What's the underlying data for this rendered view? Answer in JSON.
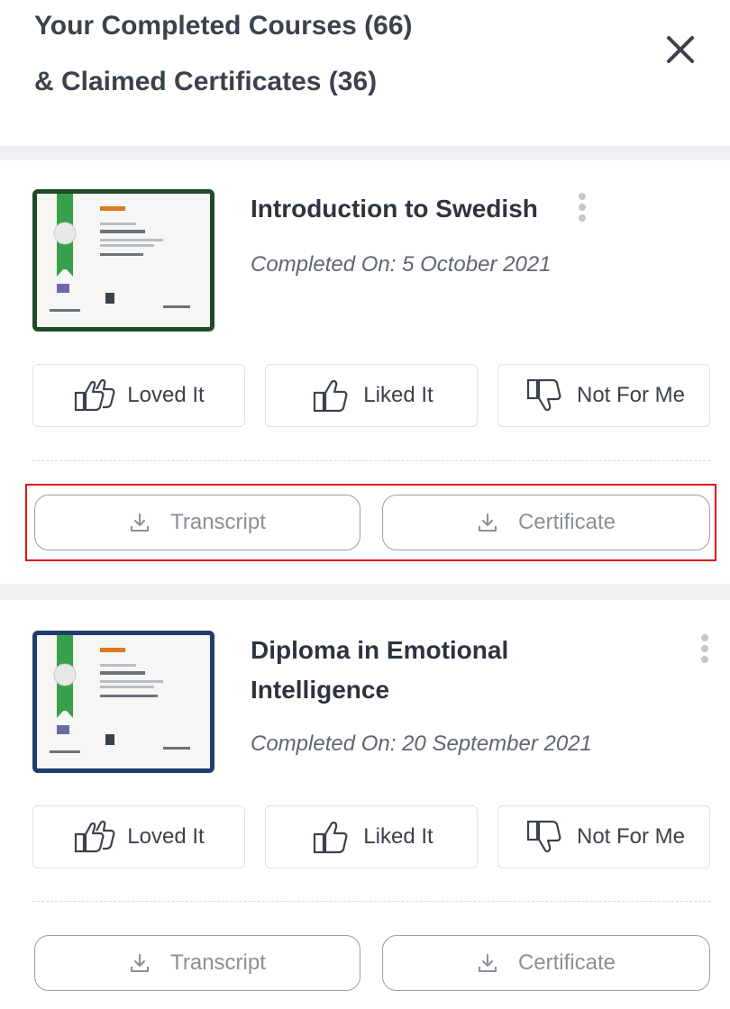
{
  "header": {
    "title_line1": "Your Completed Courses (66)",
    "title_line2": "& Claimed Certificates (36)"
  },
  "colors": {
    "highlight": "#e3111b",
    "thumb_frame_1": "#1f4a26",
    "thumb_frame_2": "#1f3d6b",
    "ribbon": "#38a04a"
  },
  "courses": [
    {
      "title_lines": [
        "Introduction to Swedish"
      ],
      "date": "Completed On: 5 October 2021",
      "thumbnail_icon": "certificate-thumbnail",
      "reactions": [
        "Loved It",
        "Liked It",
        "Not For Me"
      ],
      "downloads": [
        "Transcript",
        "Certificate"
      ]
    },
    {
      "title_lines": [
        "Diploma in Emotional",
        "Intelligence"
      ],
      "date": "Completed On: 20 September 2021",
      "thumbnail_icon": "certificate-thumbnail",
      "reactions": [
        "Loved It",
        "Liked It",
        "Not For Me"
      ],
      "downloads": [
        "Transcript",
        "Certificate"
      ]
    }
  ]
}
